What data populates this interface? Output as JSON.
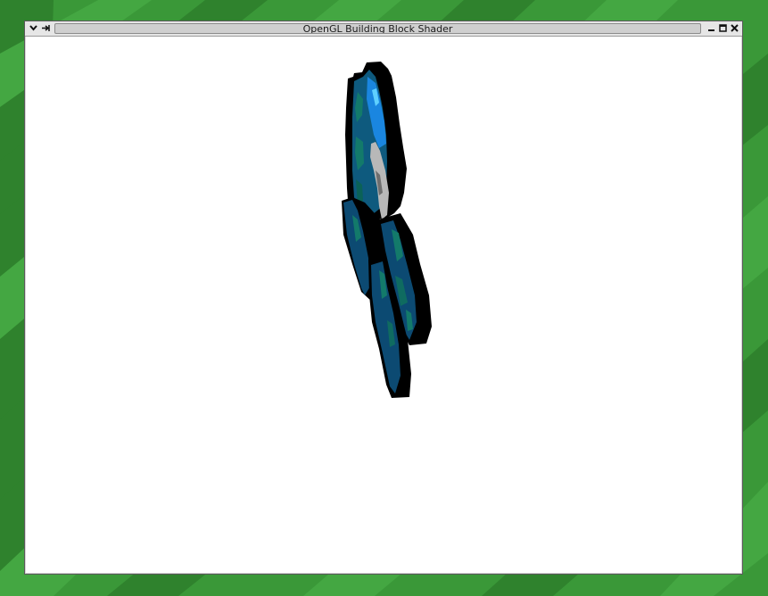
{
  "desktop": {
    "background_colors": [
      "#3c9a3a",
      "#2f7f2d",
      "#45a843"
    ]
  },
  "window": {
    "title": "OpenGL Building Block Shader",
    "menu_icon": "chevron-down-icon",
    "pin_icon": "pin-icon",
    "minimize_icon": "minimize-icon",
    "maximize_icon": "maximize-icon",
    "close_icon": "close-icon"
  },
  "viewport": {
    "background_color": "#ffffff",
    "model_colors": [
      "#000000",
      "#1e7fd6",
      "#0d4f7a",
      "#137a6a",
      "#b8b8b8"
    ]
  }
}
